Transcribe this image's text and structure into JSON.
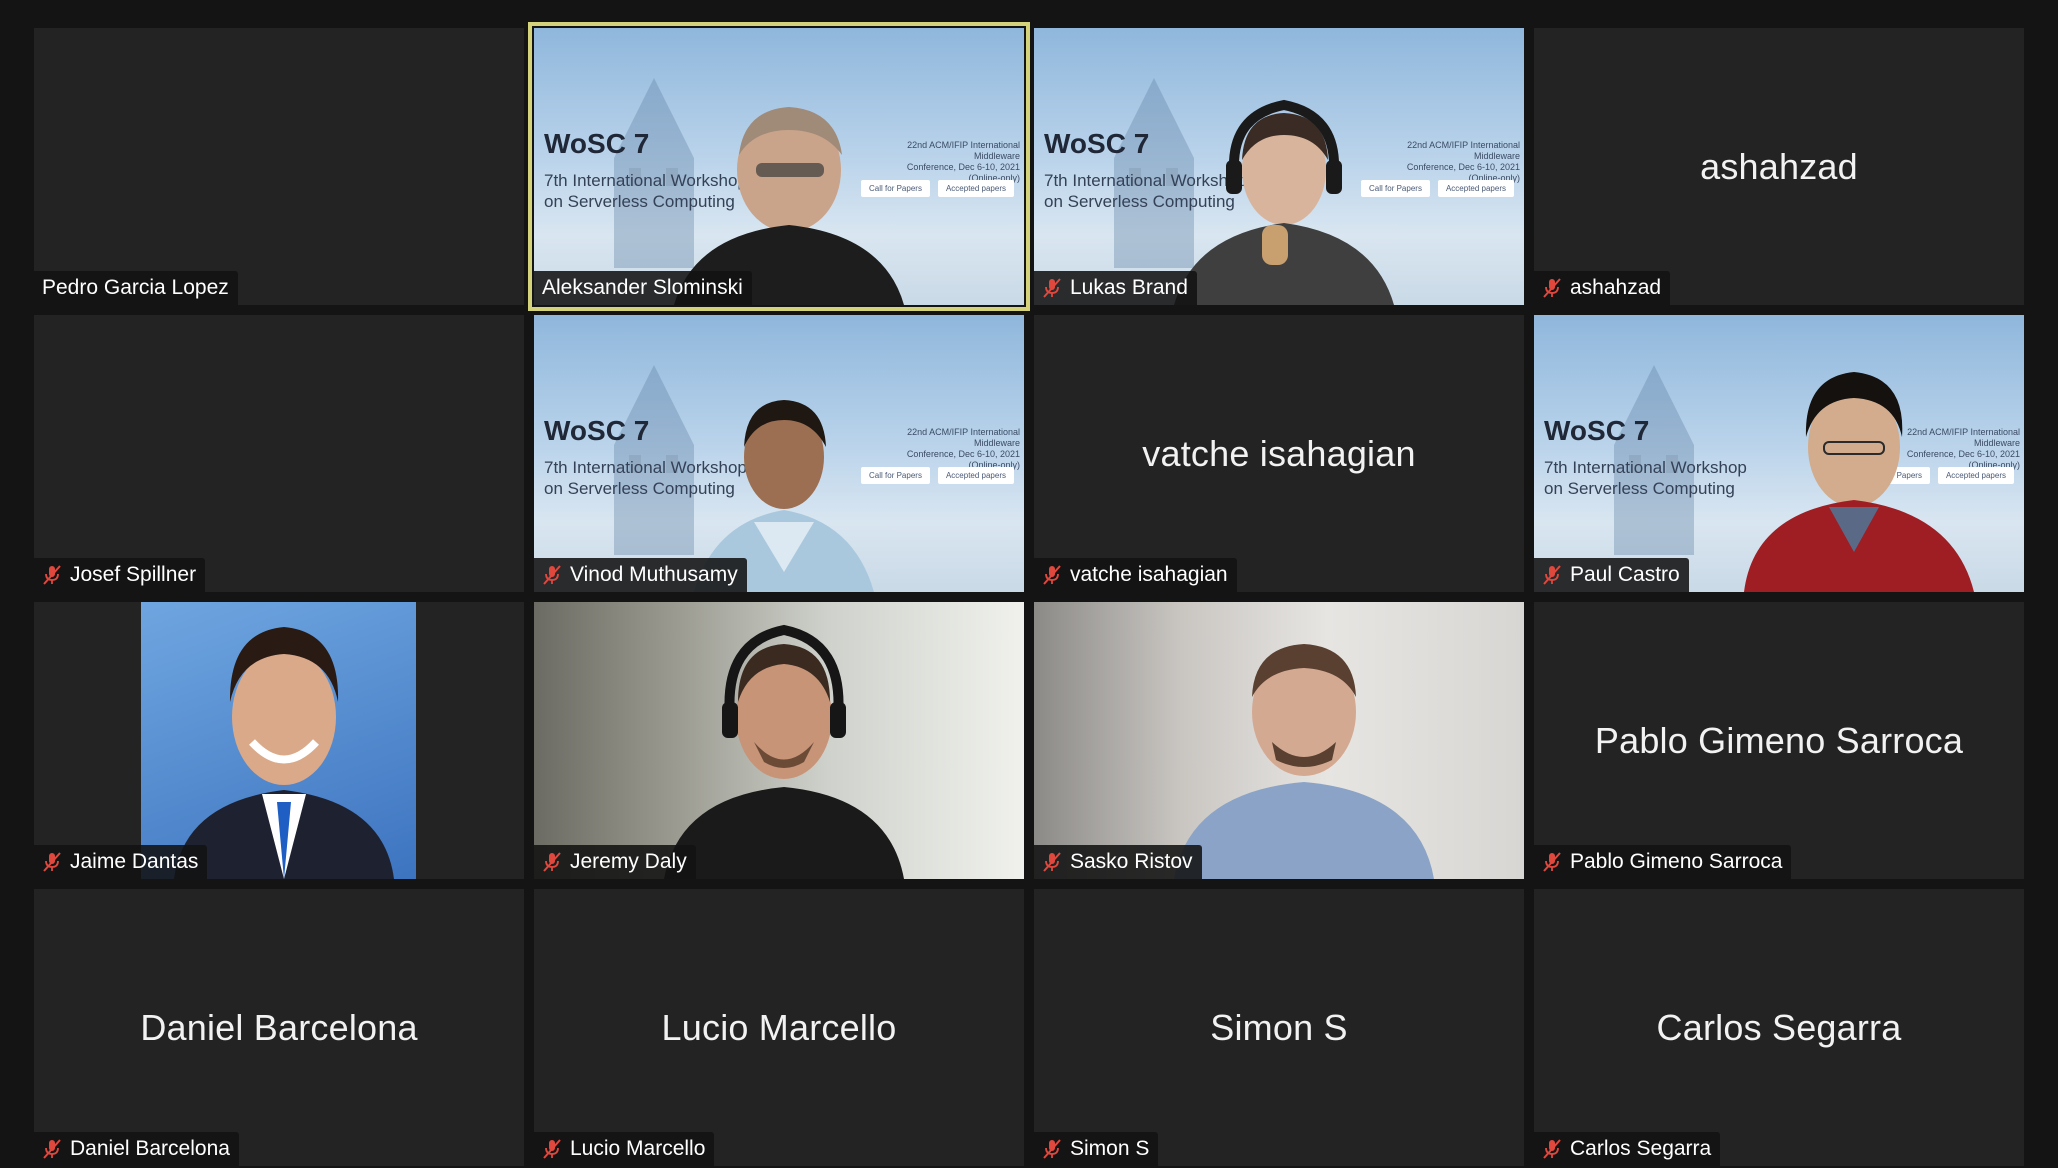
{
  "participants": [
    {
      "name": "Pedro Garcia Lopez",
      "muted": false,
      "video": false,
      "display": ""
    },
    {
      "name": "Aleksander Slominski",
      "muted": false,
      "video": true,
      "active_speaker": true
    },
    {
      "name": "Lukas Brand",
      "muted": true,
      "video": true
    },
    {
      "name": "ashahzad",
      "muted": true,
      "video": false,
      "display": "ashahzad"
    },
    {
      "name": "Josef Spillner",
      "muted": true,
      "video": false,
      "display": ""
    },
    {
      "name": "Vinod Muthusamy",
      "muted": true,
      "video": true
    },
    {
      "name": "vatche isahagian",
      "muted": true,
      "video": false,
      "display": "vatche isahagian"
    },
    {
      "name": "Paul Castro",
      "muted": true,
      "video": true
    },
    {
      "name": "Jaime Dantas",
      "muted": true,
      "video": true
    },
    {
      "name": "Jeremy Daly",
      "muted": true,
      "video": true
    },
    {
      "name": "Sasko Ristov",
      "muted": true,
      "video": true
    },
    {
      "name": "Pablo Gimeno Sarroca",
      "muted": true,
      "video": false,
      "display": "Pablo Gimeno Sarroca"
    },
    {
      "name": "Daniel Barcelona",
      "muted": true,
      "video": false,
      "display": "Daniel Barcelona"
    },
    {
      "name": "Lucio Marcello",
      "muted": true,
      "video": false,
      "display": "Lucio Marcello"
    },
    {
      "name": "Simon S",
      "muted": true,
      "video": false,
      "display": "Simon S"
    },
    {
      "name": "Carlos Segarra",
      "muted": true,
      "video": false,
      "display": "Carlos Segarra"
    }
  ],
  "virtual_background": {
    "title": "WoSC 7",
    "subtitle_line1": "7th International Workshop",
    "subtitle_line2": "on Serverless Computing",
    "conference_line1": "22nd ACM/IFIP International Middleware",
    "conference_line2": "Conference, Dec 6-10, 2021 (Online-only)",
    "button1": "Call for Papers",
    "button2": "Accepted papers"
  },
  "colors": {
    "background": "#141414",
    "tile": "#232323",
    "active_speaker_border": "#d4d27a",
    "muted_icon": "#e0483e"
  },
  "icons": {
    "muted": "microphone-muted-icon"
  }
}
